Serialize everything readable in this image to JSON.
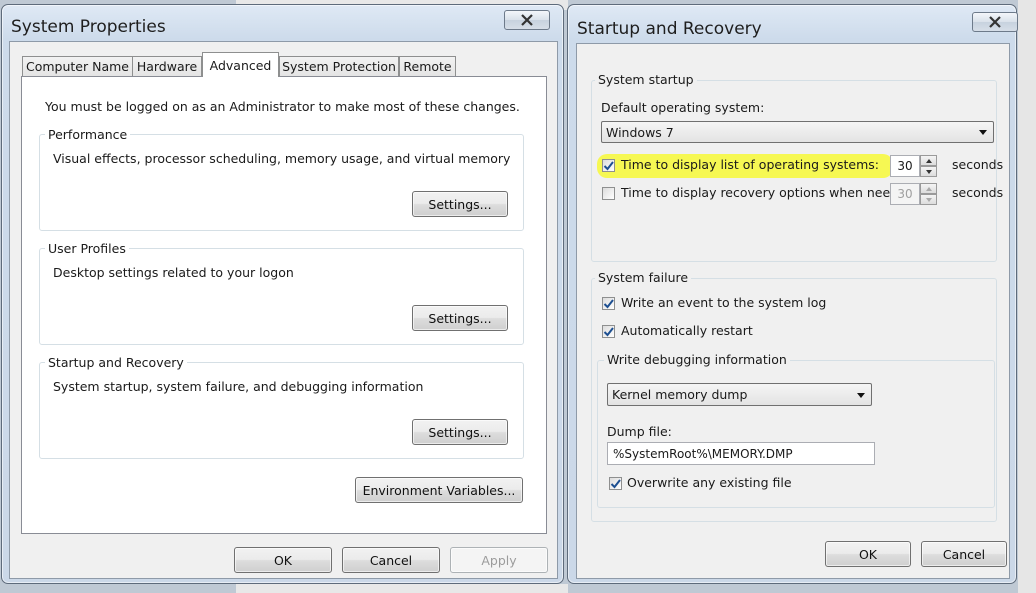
{
  "system_properties": {
    "title": "System Properties",
    "tabs": [
      "Computer Name",
      "Hardware",
      "Advanced",
      "System Protection",
      "Remote"
    ],
    "active_tab": "Advanced",
    "admin_note": "You must be logged on as an Administrator to make most of these changes.",
    "performance": {
      "label": "Performance",
      "description": "Visual effects, processor scheduling, memory usage, and virtual memory",
      "settings_label": "Settings..."
    },
    "user_profiles": {
      "label": "User Profiles",
      "description": "Desktop settings related to your logon",
      "settings_label": "Settings..."
    },
    "startup_recovery": {
      "label": "Startup and Recovery",
      "description": "System startup, system failure, and debugging information",
      "settings_label": "Settings..."
    },
    "env_vars_label": "Environment Variables...",
    "ok_label": "OK",
    "cancel_label": "Cancel",
    "apply_label": "Apply"
  },
  "startup_recovery_dialog": {
    "title": "Startup and Recovery",
    "system_startup": {
      "label": "System startup",
      "default_os_label": "Default operating system:",
      "default_os_value": "Windows 7",
      "display_list": {
        "label": "Time to display list of operating systems:",
        "checked": true,
        "value": "30",
        "unit": "seconds"
      },
      "display_recovery": {
        "label": "Time to display recovery options when needed",
        "checked": false,
        "value": "30",
        "unit": "seconds"
      }
    },
    "system_failure": {
      "label": "System failure",
      "write_event_label": "Write an event to the system log",
      "write_event_checked": true,
      "auto_restart_label": "Automatically restart",
      "auto_restart_checked": true,
      "debug_info": {
        "label": "Write debugging information",
        "dump_type": "Kernel memory dump",
        "dump_file_label": "Dump file:",
        "dump_file_value": "%SystemRoot%\\MEMORY.DMP",
        "overwrite_label": "Overwrite any existing file",
        "overwrite_checked": true
      }
    },
    "ok_label": "OK",
    "cancel_label": "Cancel"
  },
  "colors": {
    "highlight": "#f6f84a",
    "window_frame": "#cbd8e8",
    "client_bg": "#f0f0f0"
  }
}
